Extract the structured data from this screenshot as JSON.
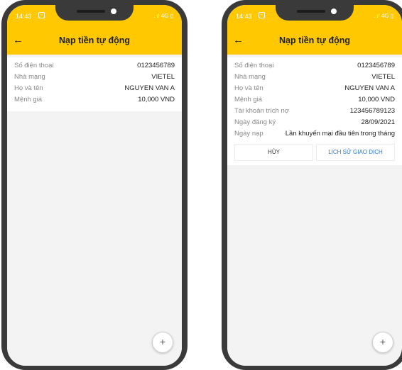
{
  "status_bar": {
    "time": "14:43",
    "right_icons": "..ıl 4G ▯"
  },
  "header": {
    "title": "Nạp tiền tự động",
    "back_icon": "arrow-left-icon"
  },
  "screen_left": {
    "fields": [
      {
        "label": "Số điện thoại",
        "value": "0123456789"
      },
      {
        "label": "Nhà mạng",
        "value": "VIETEL"
      },
      {
        "label": "Họ và tên",
        "value": "NGUYEN VAN A"
      },
      {
        "label": "Mệnh giá",
        "value": "10,000 VND"
      }
    ]
  },
  "screen_right": {
    "fields": [
      {
        "label": "Số điện thoại",
        "value": "0123456789"
      },
      {
        "label": "Nhà mạng",
        "value": "VIETEL"
      },
      {
        "label": "Họ và tên",
        "value": "NGUYEN VAN A"
      },
      {
        "label": "Mệnh giá",
        "value": "10,000 VND"
      },
      {
        "label": "Tài khoản trích nợ",
        "value": "123456789123"
      },
      {
        "label": "Ngày đăng ký",
        "value": "28/09/2021"
      },
      {
        "label": "Ngày nạp",
        "value": "Lần khuyến mại đầu tiên trong tháng"
      }
    ],
    "cancel_label": "HỦY",
    "history_label": "LỊCH SỬ GIAO DỊCH"
  },
  "fab_label": "+",
  "colors": {
    "header": "#ffc800",
    "link": "#2a78d4"
  }
}
